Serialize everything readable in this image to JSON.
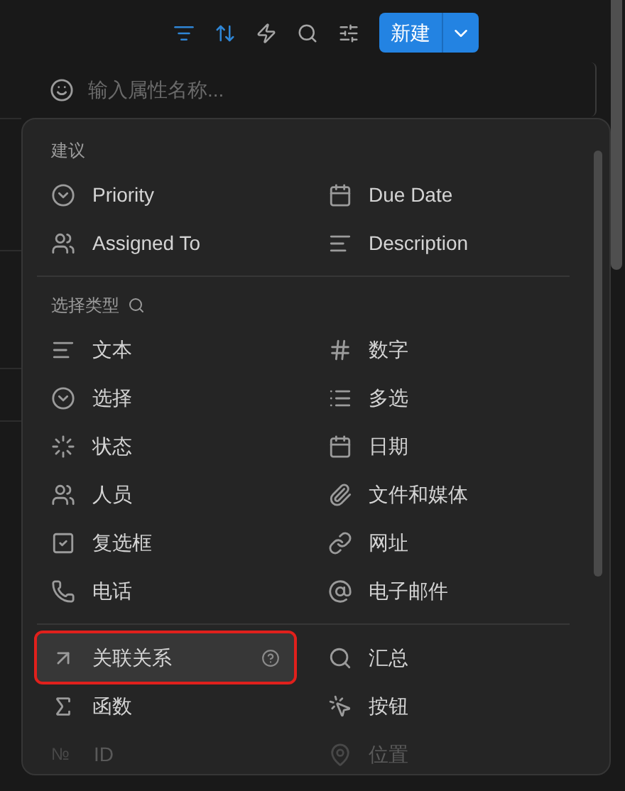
{
  "toolbar": {
    "tools": [
      {
        "kind": "filter",
        "active": true
      },
      {
        "kind": "sort",
        "active": true
      },
      {
        "kind": "automation",
        "active": false
      },
      {
        "kind": "search",
        "active": false
      },
      {
        "kind": "settings",
        "active": false
      }
    ],
    "new_button": {
      "label": "新建"
    }
  },
  "property_name_field": {
    "placeholder": "输入属性名称..."
  },
  "menu": {
    "sections": [
      {
        "title": "建议",
        "searchable": false,
        "items": [
          {
            "kind": "select",
            "label": "Priority",
            "selected": false,
            "highlighted": false,
            "help": false,
            "faded": false
          },
          {
            "kind": "date",
            "label": "Due Date",
            "selected": false,
            "highlighted": false,
            "help": false,
            "faded": false
          },
          {
            "kind": "person",
            "label": "Assigned To",
            "selected": false,
            "highlighted": false,
            "help": false,
            "faded": false
          },
          {
            "kind": "text",
            "label": "Description",
            "selected": false,
            "highlighted": false,
            "help": false,
            "faded": false
          }
        ]
      },
      {
        "title": "选择类型",
        "searchable": true,
        "items": [
          {
            "kind": "text",
            "label": "文本",
            "selected": false,
            "highlighted": false,
            "help": false,
            "faded": false
          },
          {
            "kind": "number",
            "label": "数字",
            "selected": false,
            "highlighted": false,
            "help": false,
            "faded": false
          },
          {
            "kind": "select",
            "label": "选择",
            "selected": false,
            "highlighted": false,
            "help": false,
            "faded": false
          },
          {
            "kind": "multi_select",
            "label": "多选",
            "selected": false,
            "highlighted": false,
            "help": false,
            "faded": false
          },
          {
            "kind": "status",
            "label": "状态",
            "selected": false,
            "highlighted": false,
            "help": false,
            "faded": false
          },
          {
            "kind": "date",
            "label": "日期",
            "selected": false,
            "highlighted": false,
            "help": false,
            "faded": false
          },
          {
            "kind": "person",
            "label": "人员",
            "selected": false,
            "highlighted": false,
            "help": false,
            "faded": false
          },
          {
            "kind": "files",
            "label": "文件和媒体",
            "selected": false,
            "highlighted": false,
            "help": false,
            "faded": false
          },
          {
            "kind": "checkbox",
            "label": "复选框",
            "selected": false,
            "highlighted": false,
            "help": false,
            "faded": false
          },
          {
            "kind": "url",
            "label": "网址",
            "selected": false,
            "highlighted": false,
            "help": false,
            "faded": false
          },
          {
            "kind": "phone",
            "label": "电话",
            "selected": false,
            "highlighted": false,
            "help": false,
            "faded": false
          },
          {
            "kind": "email",
            "label": "电子邮件",
            "selected": false,
            "highlighted": false,
            "help": false,
            "faded": false
          }
        ]
      },
      {
        "items": [
          {
            "kind": "relation",
            "label": "关联关系",
            "selected": true,
            "highlighted": true,
            "help": true,
            "faded": false
          },
          {
            "kind": "rollup",
            "label": "汇总",
            "selected": false,
            "highlighted": false,
            "help": false,
            "faded": false
          },
          {
            "kind": "formula",
            "label": "函数",
            "selected": false,
            "highlighted": false,
            "help": false,
            "faded": false
          },
          {
            "kind": "button",
            "label": "按钮",
            "selected": false,
            "highlighted": false,
            "help": false,
            "faded": false
          },
          {
            "kind": "id",
            "label": "ID",
            "icon_text": "№",
            "selected": false,
            "highlighted": false,
            "help": false,
            "faded": true
          },
          {
            "kind": "location",
            "label": "位置",
            "selected": false,
            "highlighted": false,
            "help": false,
            "faded": true
          }
        ]
      }
    ]
  }
}
